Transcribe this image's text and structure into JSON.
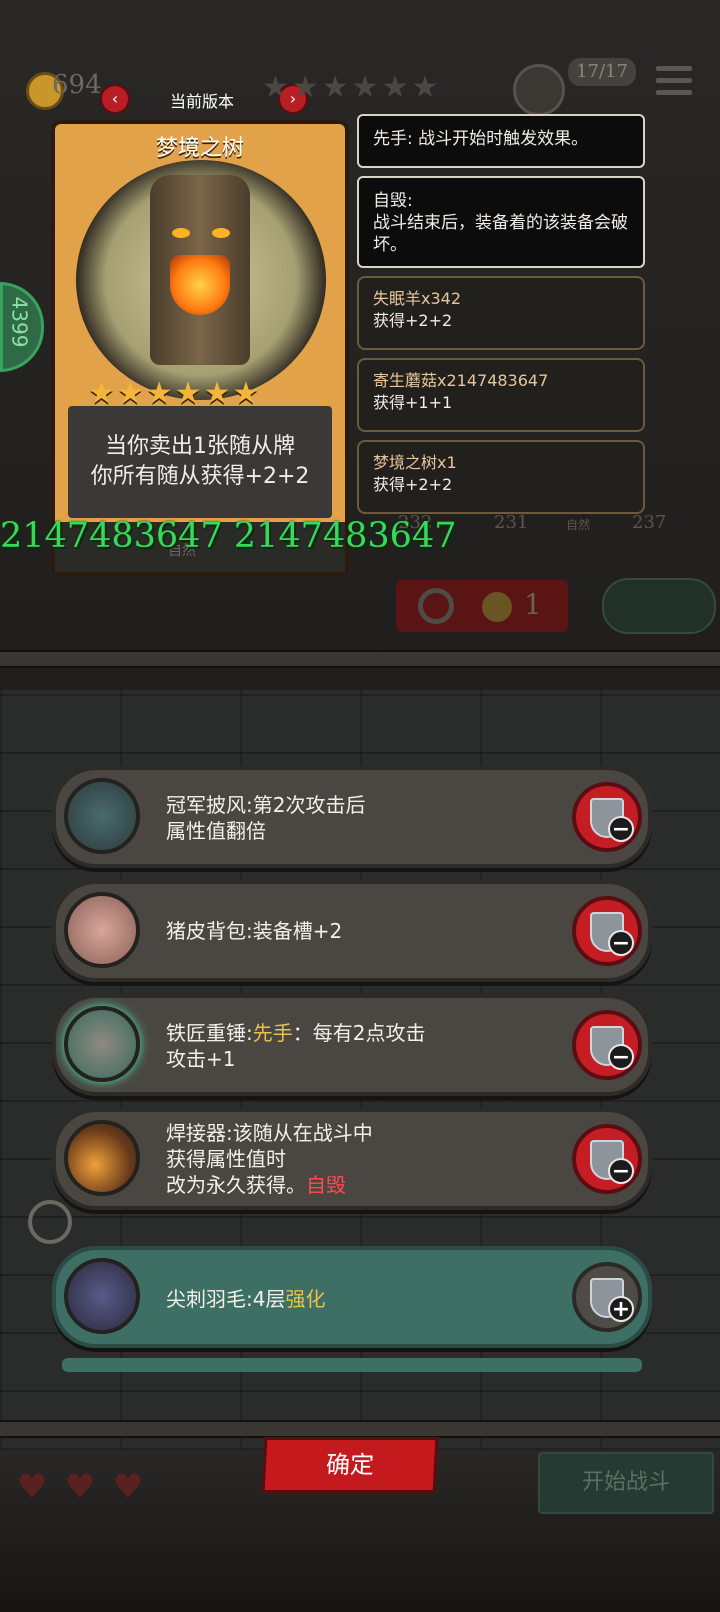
{
  "header": {
    "coins": "694",
    "version_label": "当前版本",
    "prev": "‹",
    "next": "›",
    "stars": "★★★★★★",
    "unit_count": "17/17"
  },
  "card": {
    "name": "梦境之树",
    "stars": "★★★★★★",
    "desc_line1": "当你卖出1张随从牌",
    "desc_line2": "你所有随从获得+2+2",
    "tag": "自然",
    "stats_text": "2147483647 2147483647"
  },
  "info": {
    "first_strike": "先手: 战斗开始时触发效果。",
    "self_destruct_title": "自毁:",
    "self_destruct_desc": "战斗结束后，装备着的该装备会破坏。"
  },
  "buffs": [
    {
      "name": "失眠羊x342",
      "gain": "获得+2+2"
    },
    {
      "name": "寄生蘑菇x2147483647",
      "gain": "获得+1+1"
    },
    {
      "name": "梦境之树x1",
      "gain": "获得+2+2"
    }
  ],
  "behind": {
    "num1": "232",
    "num2": "231",
    "num3": "237",
    "tag2": "自然",
    "refresh_cost": "1",
    "left_num": "4399"
  },
  "equipment": [
    {
      "name": "冠军披风:",
      "line1_rest": "第2次攻击后",
      "line2": "属性值翻倍"
    },
    {
      "name": "猪皮背包:",
      "line1_rest": "装备槽+2"
    },
    {
      "name": "铁匠重锤:",
      "hl": "先手",
      "line1_rest": "：每有2点攻击",
      "line2": "攻击+1"
    },
    {
      "name": "焊接器:",
      "line1_rest": "该随从在战斗中",
      "line2": "获得属性值时",
      "line3": "改为永久获得。",
      "hl_red": "自毁"
    },
    {
      "name": "尖刺羽毛:",
      "line1_rest": "4层",
      "hl": "强化"
    }
  ],
  "bottom": {
    "confirm": "确定",
    "start_battle": "开始战斗",
    "hearts": [
      "♥",
      "♥",
      "♥"
    ]
  },
  "colors": {
    "accent_red": "#c41a1e",
    "card_gold": "#e1a24a",
    "stat_green": "#38d95a",
    "teal_row": "#3e6f64"
  }
}
